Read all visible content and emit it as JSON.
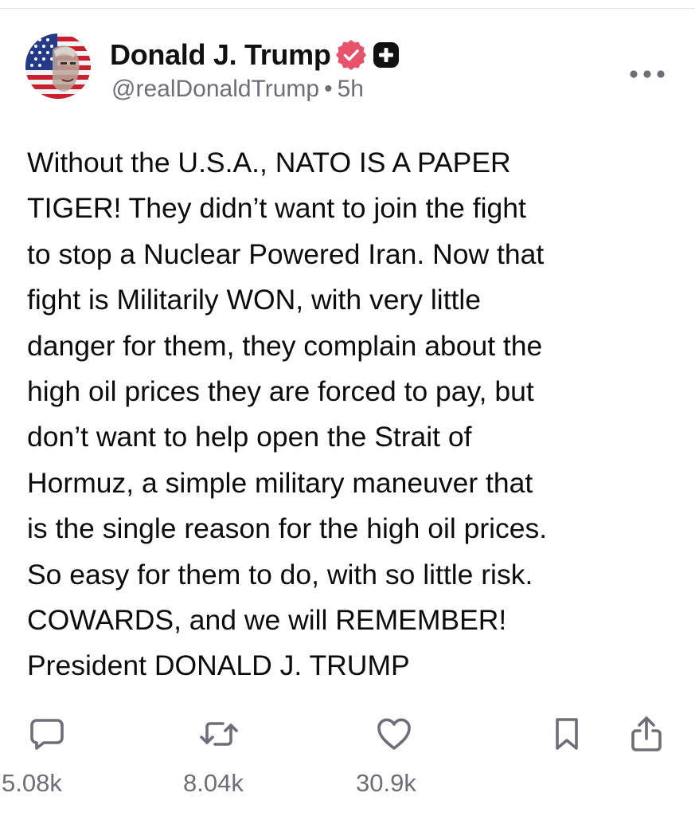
{
  "post": {
    "author": {
      "display_name": "Donald J. Trump",
      "handle": "@realDonaldTrump",
      "separator": "•",
      "time_ago": "5h",
      "badges": [
        "verified-badge-icon",
        "plus-badge-icon"
      ]
    },
    "body_lines": [
      "Without the U.S.A., NATO IS A PAPER",
      "TIGER! They didn’t want to join the fight",
      "to stop a Nuclear Powered Iran. Now that",
      "fight is Militarily WON, with very little",
      "danger for them, they complain about the",
      "high oil prices they are forced to pay, but",
      "don’t want to help open the Strait of",
      "Hormuz, a simple military maneuver that",
      "is the single reason for the high oil prices.",
      "So easy for them to do, with so little risk.",
      "COWARDS, and we will REMEMBER!",
      "President DONALD J. TRUMP"
    ],
    "actions": {
      "reply": {
        "icon": "reply-icon",
        "count": "5.08k"
      },
      "repost": {
        "icon": "repost-icon",
        "count": "8.04k"
      },
      "like": {
        "icon": "heart-icon",
        "count": "30.9k"
      },
      "bookmark": {
        "icon": "bookmark-icon"
      },
      "share": {
        "icon": "share-icon"
      }
    },
    "more_icon": "more-horizontal-icon"
  },
  "colors": {
    "text_primary": "#111111",
    "text_secondary": "#6e6e78",
    "verified_badge": "#e8526b",
    "plus_badge": "#111111",
    "divider": "#e7e7ea",
    "icon_gray": "#6e6e78"
  }
}
